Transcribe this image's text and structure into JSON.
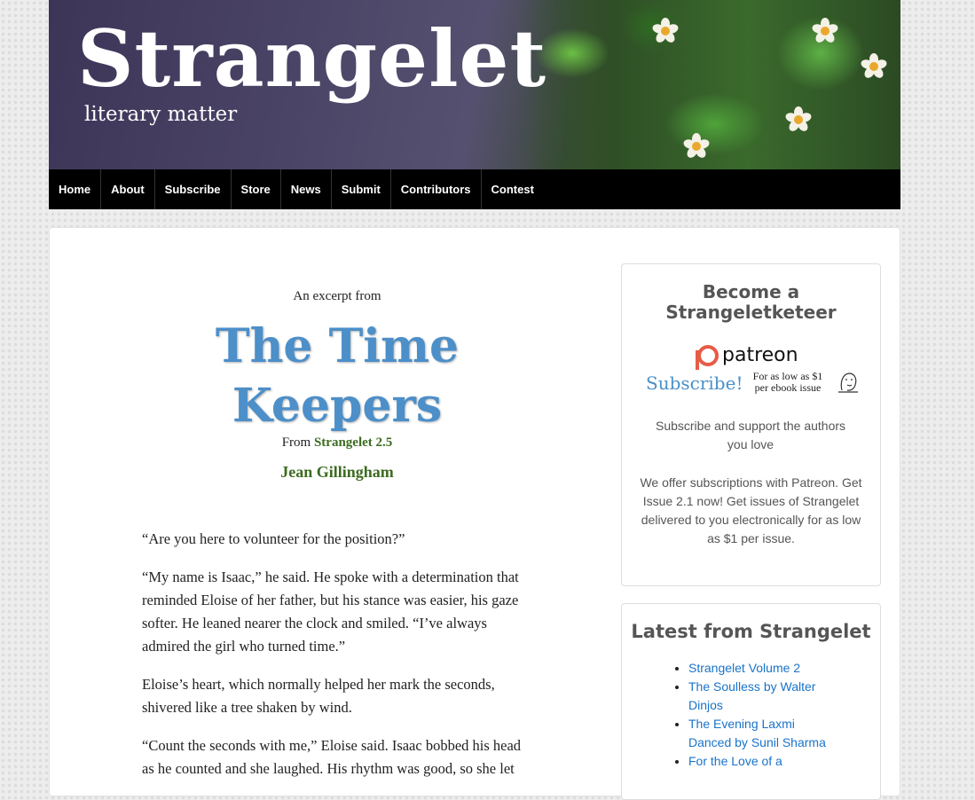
{
  "header": {
    "site_title": "Strangelet",
    "tagline": "literary matter"
  },
  "nav": {
    "items": [
      "Home",
      "About",
      "Subscribe",
      "Store",
      "News",
      "Submit",
      "Contributors",
      "Contest"
    ]
  },
  "article": {
    "kicker": "An excerpt from",
    "title": "The Time Keepers",
    "from_label": "From",
    "issue": "Strangelet 2.5",
    "author": "Jean Gillingham",
    "paragraphs": [
      "“Are you here to volunteer for the position?”",
      "“My name is Isaac,” he said. He spoke with a determination that reminded Eloise of her father, but his stance was easier, his gaze softer. He leaned nearer the clock and smiled. “I’ve always admired the girl who turned time.”",
      "Eloise’s heart, which normally helped her mark the seconds, shivered like a tree shaken by wind.",
      "“Count the seconds with me,” Eloise said. Isaac bobbed his head as he counted and she laughed. His rhythm was good, so she let"
    ]
  },
  "sidebar": {
    "subscribe_widget": {
      "title": "Become a Strangeletketeer",
      "patreon_word": "patreon",
      "patreon_subscribe": "Subscribe!",
      "patreon_low": "For as low as $1 per ebook issue",
      "support_text": "Subscribe and support the authors you love",
      "offer_text": "We offer subscriptions with Patreon. Get Issue 2.1 now! Get issues of Strangelet delivered to you electronically for as low as $1 per issue."
    },
    "latest_widget": {
      "title": "Latest from Strangelet",
      "items": [
        "Strangelet Volume 2",
        "The Soulless by Walter Dinjos",
        "The Evening Laxmi Danced by Sunil Sharma",
        "For the Love of a"
      ]
    }
  }
}
